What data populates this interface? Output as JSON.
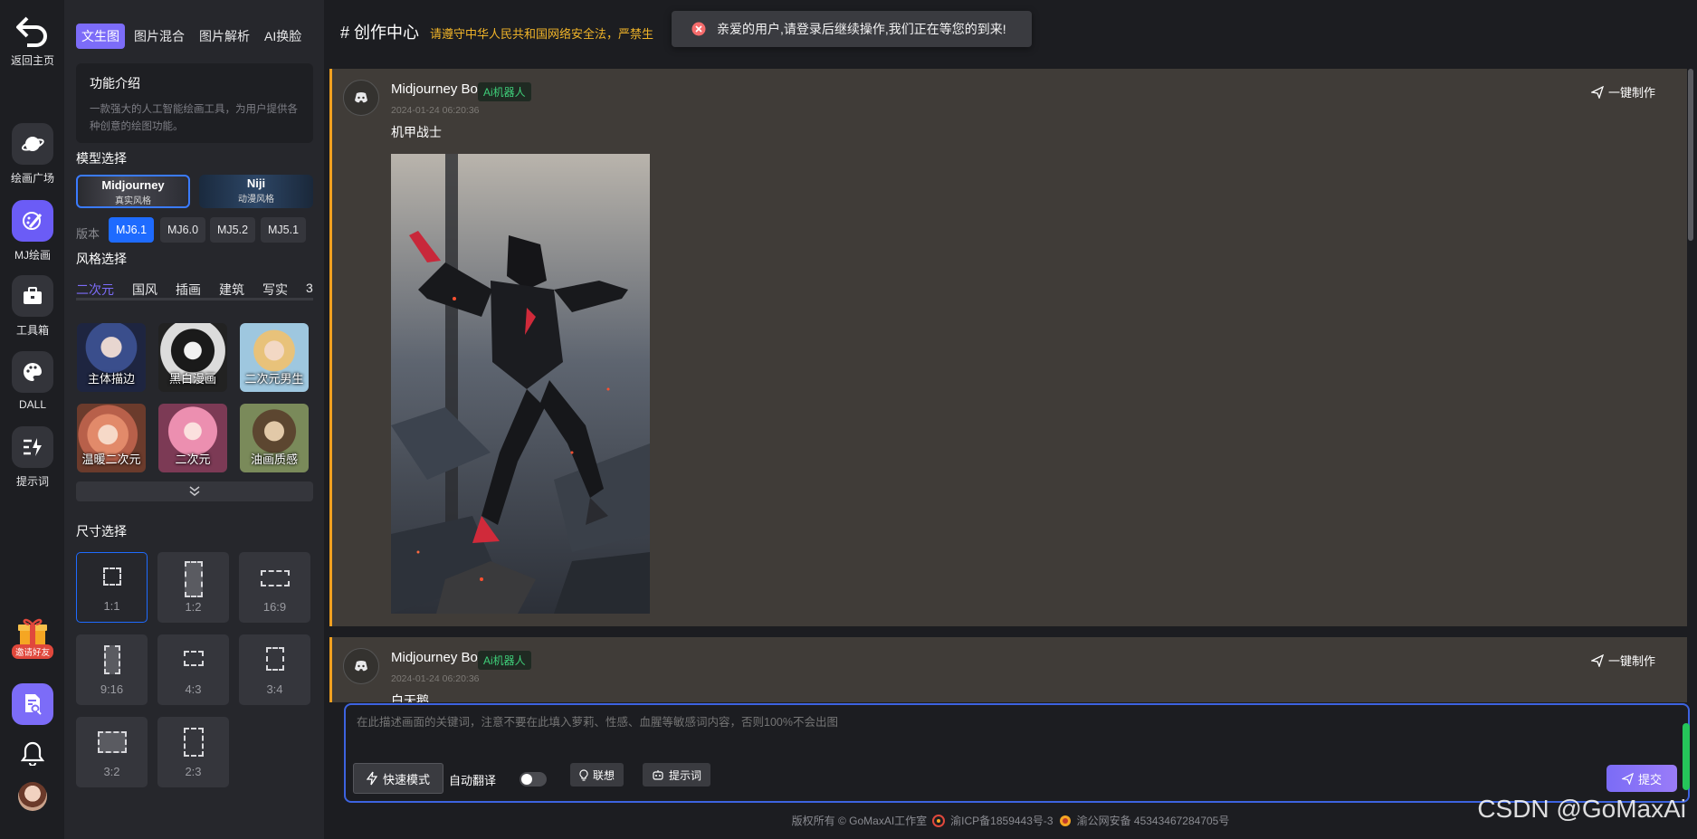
{
  "rail": {
    "items": [
      {
        "label": "返回主页",
        "icon": "return-home-icon"
      },
      {
        "label": "绘画广场",
        "icon": "planet-icon"
      },
      {
        "label": "MJ绘画",
        "icon": "paint-brush-icon"
      },
      {
        "label": "工具箱",
        "icon": "toolbox-icon"
      },
      {
        "label": "DALL",
        "icon": "palette-icon"
      },
      {
        "label": "提示词",
        "icon": "lightning-text-icon"
      }
    ],
    "invite_badge": "邀请好友"
  },
  "panel": {
    "tabs": [
      "文生图",
      "图片混合",
      "图片解析",
      "AI换脸"
    ],
    "intro": {
      "title": "功能介绍",
      "desc": "一款强大的人工智能绘画工具，为用户提供各种创意的绘图功能。"
    },
    "model_title": "模型选择",
    "models": [
      {
        "name": "Midjourney",
        "sub": "真实风格"
      },
      {
        "name": "Niji",
        "sub": "动漫风格"
      }
    ],
    "version_label": "版本",
    "versions": [
      "MJ6.1",
      "MJ6.0",
      "MJ5.2",
      "MJ5.1"
    ],
    "style_title": "风格选择",
    "style_tabs": [
      "二次元",
      "国风",
      "插画",
      "建筑",
      "写实",
      "3"
    ],
    "styles": [
      "主体描边",
      "黑白漫画",
      "二次元男生",
      "温暖二次元",
      "二次元",
      "油画质感"
    ],
    "size_title": "尺寸选择",
    "sizes": [
      "1:1",
      "1:2",
      "16:9",
      "9:16",
      "4:3",
      "3:4",
      "3:2",
      "2:3"
    ]
  },
  "header": {
    "title": "# 创作中心",
    "notice": "请遵守中华人民共和国网络安全法，严禁生"
  },
  "toast": {
    "text": "亲爱的用户,请登录后继续操作,我们正在等您的到来!"
  },
  "messages": [
    {
      "bot": "Midjourney Bot",
      "tag": "Ai机器人",
      "time": "2024-01-24 06:20:36",
      "prompt": "机甲战士",
      "action": "一键制作"
    },
    {
      "bot": "Midjourney Bot",
      "tag": "Ai机器人",
      "time": "2024-01-24 06:20:36",
      "prompt": "白天鹅",
      "action": "一键制作"
    }
  ],
  "composer": {
    "placeholder": "在此描述画面的关键词，注意不要在此填入萝莉、性感、血腥等敏感词内容，否则100%不会出图",
    "fast_mode": "快速模式",
    "auto_translate": "自动翻译",
    "associate": "联想",
    "prompt_words": "提示词",
    "submit": "提交"
  },
  "footer": {
    "copyright": "版权所有 © GoMaxAI工作室",
    "icp": "渝ICP备1859443号-3",
    "police": "渝公网安备 45343467284705号"
  },
  "watermark": "CSDN @GoMaxAi",
  "colors": {
    "accent": "#7c6cf8",
    "blue": "#1e6bff",
    "warning": "#f0b429",
    "bot_tag": "#3fd07a",
    "message_bg": "#403c38"
  }
}
